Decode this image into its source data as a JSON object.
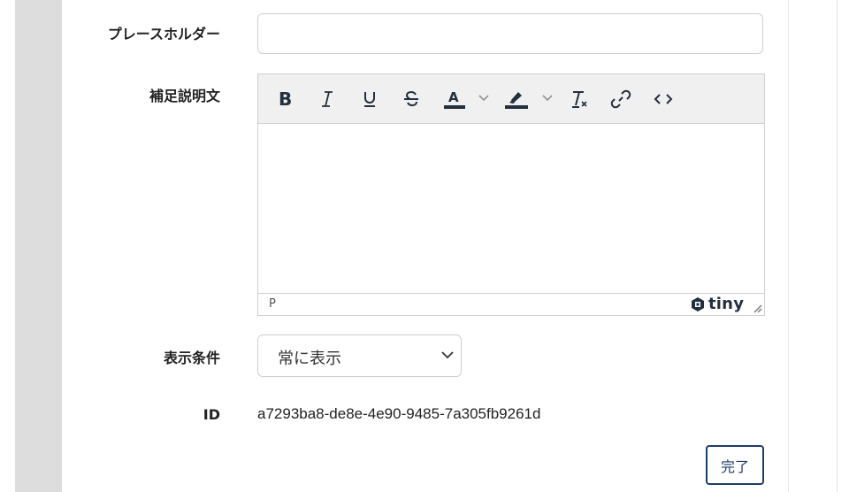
{
  "labels": {
    "placeholder": "プレースホルダー",
    "description": "補足説明文",
    "display_condition": "表示条件",
    "id": "ID"
  },
  "placeholder_input": {
    "value": ""
  },
  "editor": {
    "toolbar": [
      {
        "name": "bold-icon"
      },
      {
        "name": "italic-icon"
      },
      {
        "name": "underline-icon"
      },
      {
        "name": "strikethrough-icon"
      },
      {
        "name": "text-color-icon"
      },
      {
        "name": "highlight-color-icon"
      },
      {
        "name": "clear-formatting-icon"
      },
      {
        "name": "link-icon"
      },
      {
        "name": "source-code-icon"
      }
    ],
    "status_path": "P",
    "brand": "tiny",
    "text_color": "#222f3e"
  },
  "display_condition": {
    "selected": "常に表示"
  },
  "id_value": "a7293ba8-de8e-4e90-9485-7a305fb9261d",
  "done_label": "完了",
  "colors": {
    "accent": "#1f3b68",
    "side_band": "#dddddd"
  }
}
